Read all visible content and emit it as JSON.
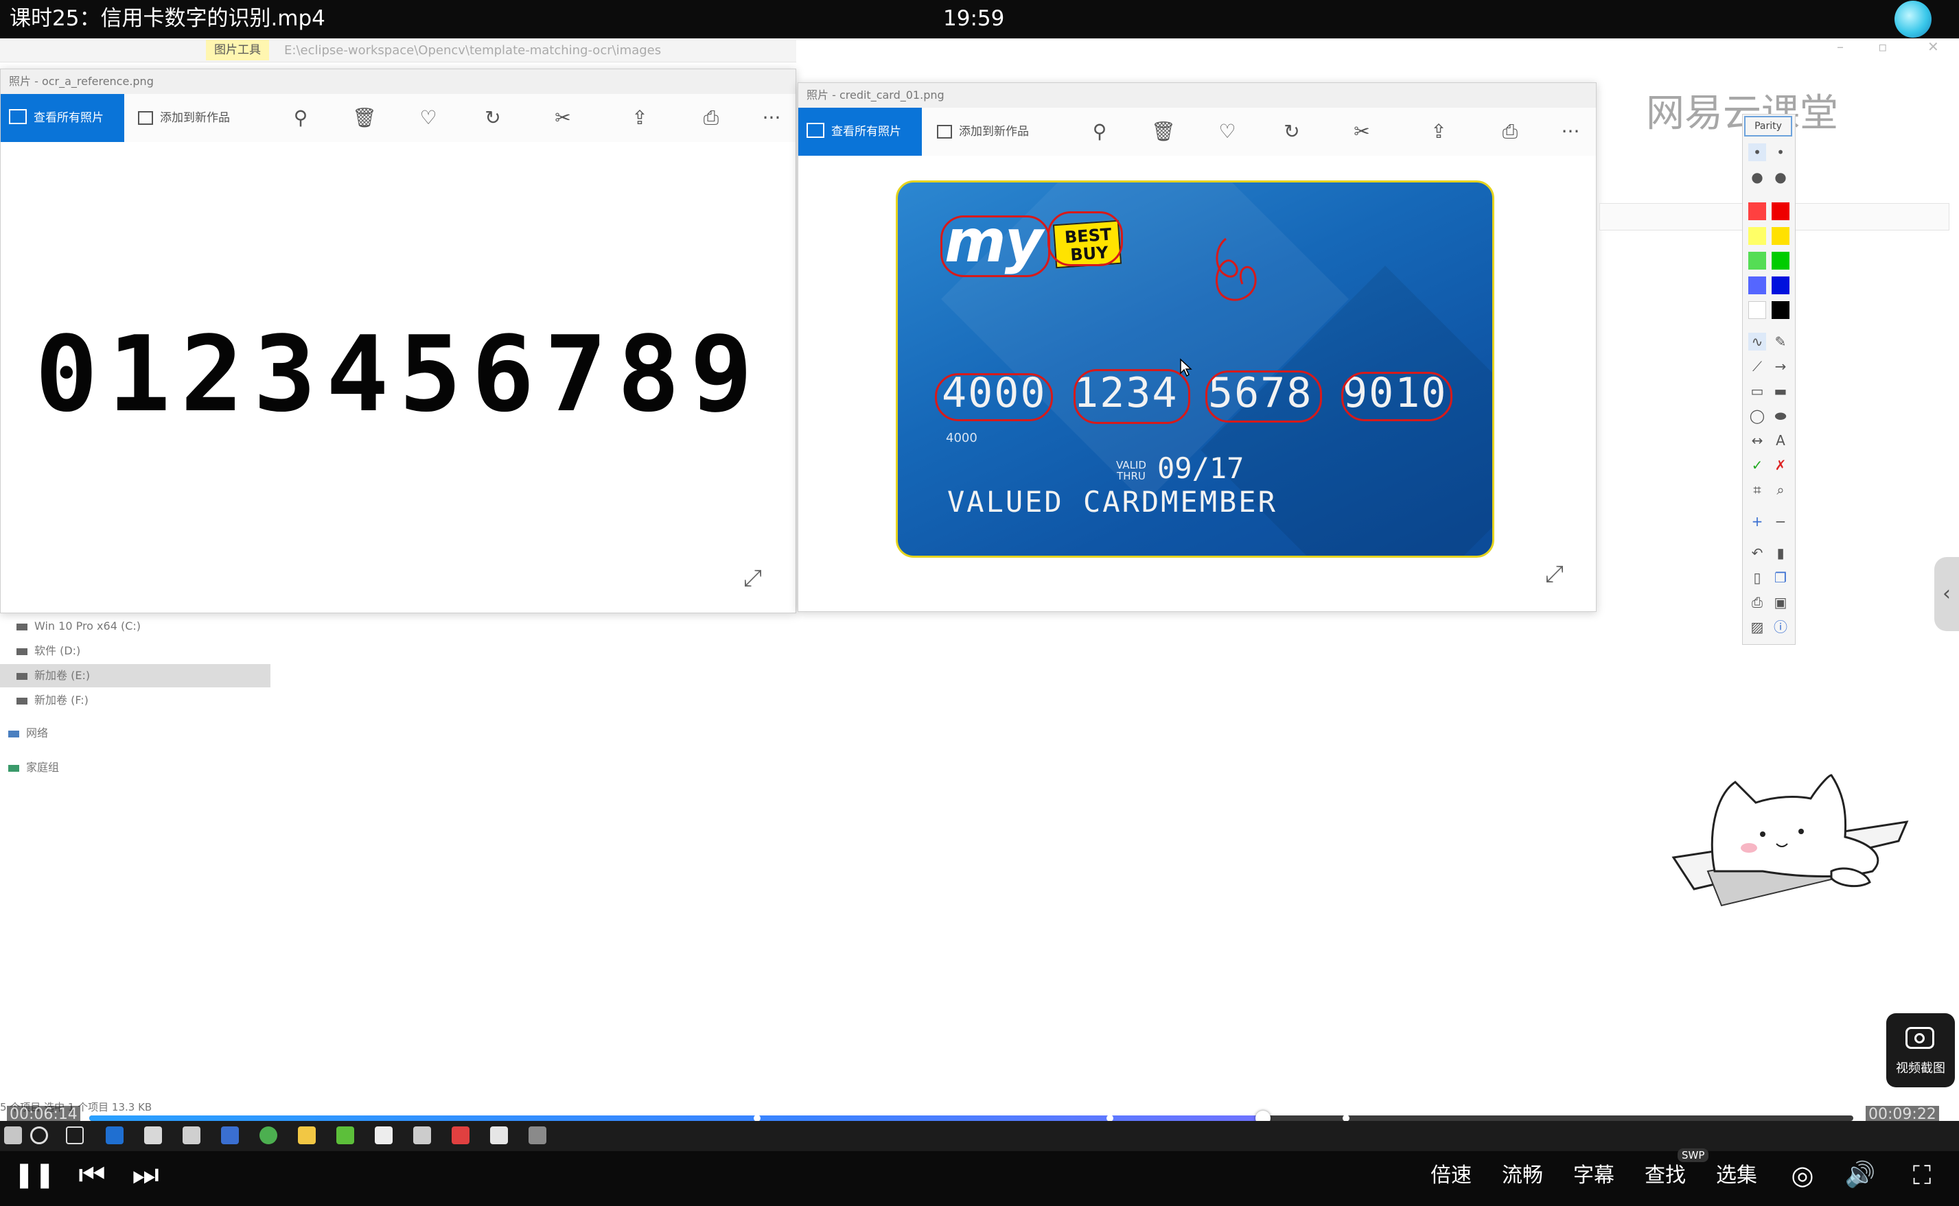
{
  "player": {
    "title": "课时25：信用卡数字的识别.mp4",
    "clock": "19:59",
    "elapsed": "00:06:14",
    "duration": "00:09:22",
    "progress_fraction": 0.6652,
    "controls": {
      "speed": "倍速",
      "quality": "流畅",
      "subtitles": "字幕",
      "search": "查找",
      "episodes": "选集",
      "swp_badge": "SWP"
    },
    "screenshot_label": "视频截图"
  },
  "explorer": {
    "ribbon_tab": "图片工具",
    "address": "E:\\eclipse-workspace\\Opencv\\template-matching-ocr\\images",
    "nav": [
      "Win 10 Pro x64 (C:)",
      "软件 (D:)",
      "新加卷 (E:)",
      "新加卷 (F:)",
      "网络",
      "家庭组"
    ],
    "status": "5 个项目    选中 1 个项目  13.3 KB"
  },
  "photo_windows": [
    {
      "title": "照片 - ocr_a_reference.png",
      "view_all": "查看所有照片",
      "add_to": "添加到新作品",
      "digits": [
        "0",
        "1",
        "2",
        "3",
        "4",
        "5",
        "6",
        "7",
        "8",
        "9"
      ]
    },
    {
      "title": "照片 - credit_card_01.png",
      "view_all": "查看所有照片",
      "add_to": "添加到新作品"
    }
  ],
  "card": {
    "brand_my": "my",
    "brand_bb_1": "BEST",
    "brand_bb_2": "BUY",
    "number_groups": [
      "4000",
      "1234",
      "5678",
      "9010"
    ],
    "small_number": "4000",
    "valid_label_1": "VALID",
    "valid_label_2": "THRU",
    "expiry": "09/17",
    "holder": "VALUED CARDMEMBER"
  },
  "watermark": "网易云课堂",
  "palette": {
    "header": "Parity",
    "colors": [
      "#ff4040",
      "#ee0000",
      "#ffff66",
      "#ffe100",
      "#55dd55",
      "#00cc00",
      "#5566ff",
      "#0011dd",
      "#ffffff",
      "#000000"
    ]
  },
  "icons": {
    "zoom": "magnifier-icon",
    "delete": "trash-icon",
    "favorite": "heart-icon",
    "rotate": "rotate-icon",
    "edit": "edit-crop-icon",
    "share": "share-icon",
    "print": "printer-icon",
    "more": "more-icon",
    "expand": "expand-icon"
  },
  "glyphs": {
    "zoom": "⚲",
    "delete": "🗑",
    "favorite": "♡",
    "rotate": "↻",
    "edit": "✂",
    "share": "⇪",
    "print": "⎙",
    "more": "···",
    "expand": "⤢",
    "pause": "❚❚",
    "prev": "⏮",
    "next": "⏭",
    "settings": "◎",
    "volume": "🔊",
    "fullscreen": "⛶",
    "side": "‹"
  }
}
